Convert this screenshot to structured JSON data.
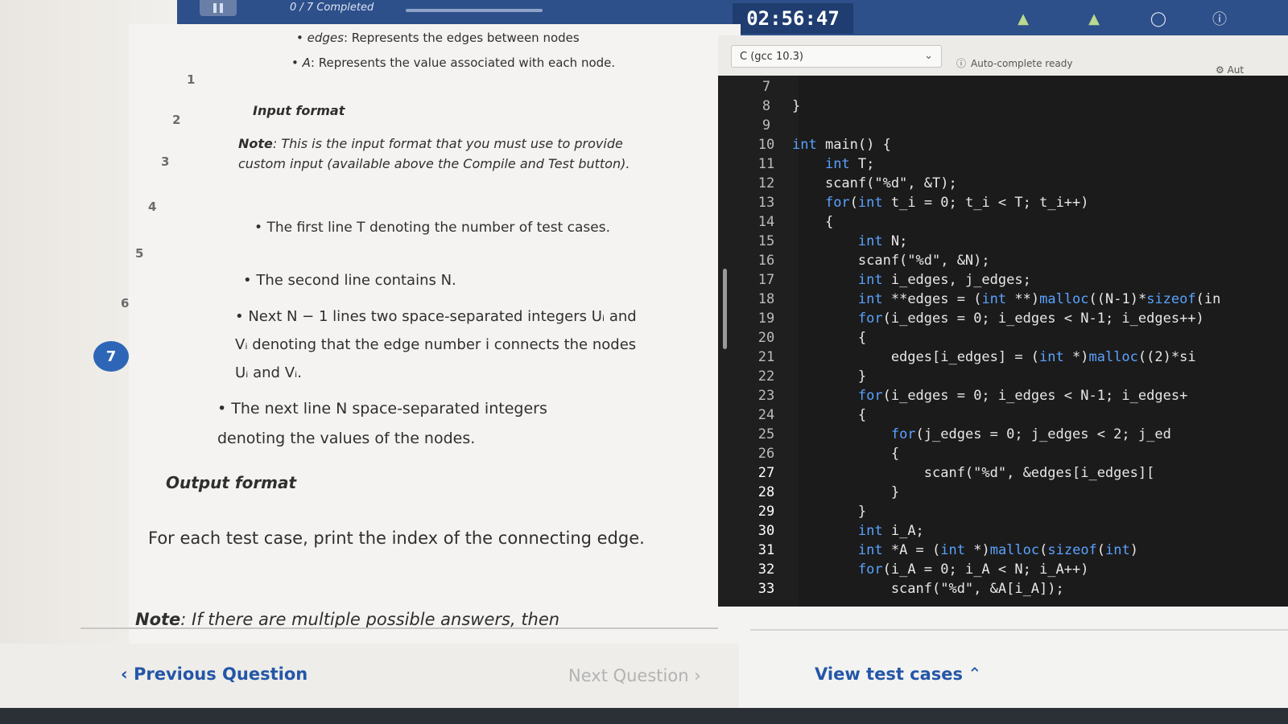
{
  "topbar": {
    "progress_label": "0 / 7 Completed",
    "progress_value": 0,
    "timer": "02:56:47",
    "icons": [
      "tree-icon",
      "tree-icon",
      "lightbulb-icon",
      "info-icon"
    ]
  },
  "question_nav": {
    "numbers": [
      "1",
      "2",
      "3",
      "4",
      "5",
      "6",
      "7"
    ],
    "active": "7"
  },
  "problem": {
    "bullet_edges_term": "edges",
    "bullet_edges_rest": ": Represents the edges between nodes",
    "bullet_a_term": "A",
    "bullet_a_rest": ": Represents the value associated with each node.",
    "input_heading": "Input format",
    "note_label": "Note",
    "note_text": ": This is the input format that you must use to provide custom input (available above the Compile and Test button).",
    "input_items": [
      "The first line T denoting the number of test cases.",
      "The second line contains N.",
      "Next N − 1 lines two space-separated integers Uᵢ and Vᵢ denoting that the edge number i connects the nodes Uᵢ and Vᵢ.",
      "The next line N space-separated integers denoting the values of the nodes."
    ],
    "output_heading": "Output format",
    "output_text": "For each test case, print the index of the connecting edge.",
    "note2_label": "Note",
    "note2_text": ": If there are multiple possible answers, then"
  },
  "editor": {
    "language": "C (gcc 10.3)",
    "autocomplete_label": "Auto-complete ready",
    "aux_label": "Aut",
    "lines": [
      {
        "n": "7",
        "code": ""
      },
      {
        "n": "8",
        "code": "}"
      },
      {
        "n": "9",
        "code": ""
      },
      {
        "n": "10",
        "code": "int main() {"
      },
      {
        "n": "11",
        "code": "    int T;"
      },
      {
        "n": "12",
        "code": "    scanf(\"%d\", &T);"
      },
      {
        "n": "13",
        "code": "    for(int t_i = 0; t_i < T; t_i++)"
      },
      {
        "n": "14",
        "code": "    {"
      },
      {
        "n": "15",
        "code": "        int N;"
      },
      {
        "n": "16",
        "code": "        scanf(\"%d\", &N);"
      },
      {
        "n": "17",
        "code": "        int i_edges, j_edges;"
      },
      {
        "n": "18",
        "code": "        int **edges = (int **)malloc((N-1)*sizeof(in"
      },
      {
        "n": "19",
        "code": "        for(i_edges = 0; i_edges < N-1; i_edges++)"
      },
      {
        "n": "20",
        "code": "        {"
      },
      {
        "n": "21",
        "code": "            edges[i_edges] = (int *)malloc((2)*si"
      },
      {
        "n": "22",
        "code": "        }"
      },
      {
        "n": "23",
        "code": "        for(i_edges = 0; i_edges < N-1; i_edges+"
      },
      {
        "n": "24",
        "code": "        {"
      },
      {
        "n": "25",
        "code": "            for(j_edges = 0; j_edges < 2; j_ed"
      },
      {
        "n": "26",
        "code": "            {"
      },
      {
        "n": "27",
        "code": "                scanf(\"%d\", &edges[i_edges]["
      },
      {
        "n": "28",
        "code": "            }"
      },
      {
        "n": "29",
        "code": "        }"
      },
      {
        "n": "30",
        "code": "        int i_A;"
      },
      {
        "n": "31",
        "code": "        int *A = (int *)malloc(sizeof(int)"
      },
      {
        "n": "32",
        "code": "        for(i_A = 0; i_A < N; i_A++)"
      },
      {
        "n": "33",
        "code": "            scanf(\"%d\", &A[i_A]);"
      }
    ],
    "view_tests_label": "View test cases"
  },
  "nav": {
    "prev_label": "Previous Question",
    "next_label": "Next Question"
  }
}
